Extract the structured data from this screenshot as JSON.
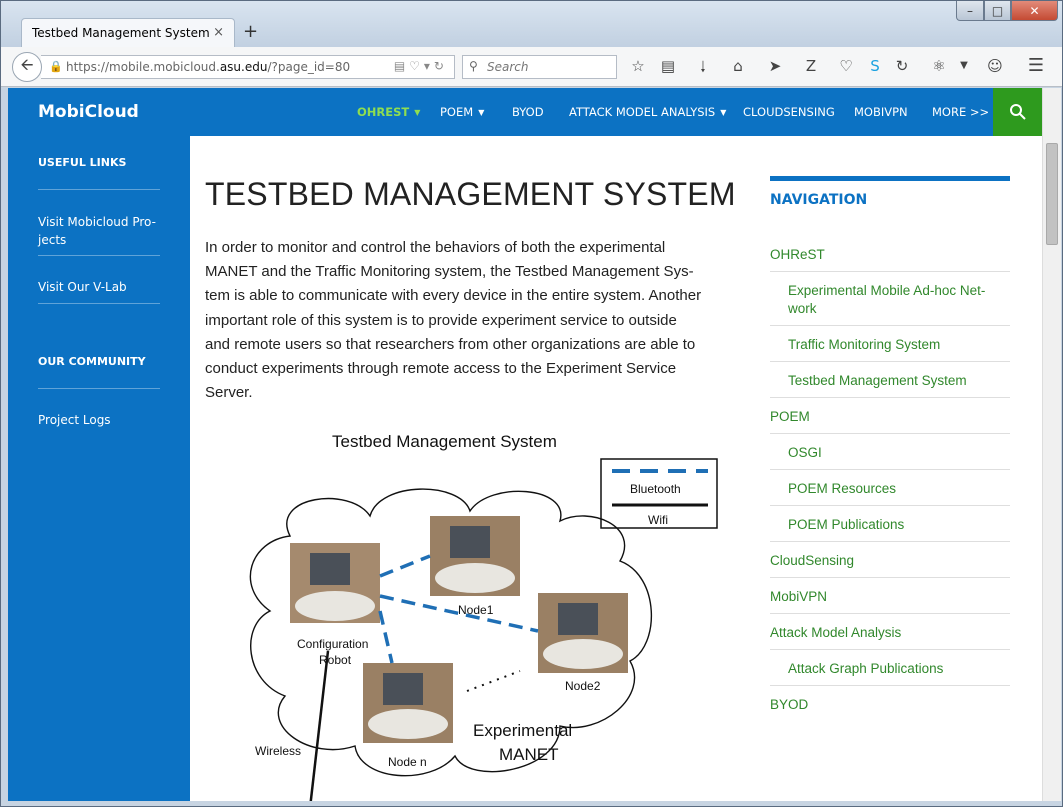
{
  "browser": {
    "tab_title": "Testbed Management System |...",
    "tab_close": "×",
    "new_tab": "+",
    "url_prefix": "https://mobile.mobicloud.",
    "url_domain": "asu.edu",
    "url_suffix": "/?page_id=80",
    "search_placeholder": "Search"
  },
  "site": {
    "brand": "MobiCloud",
    "menu": [
      {
        "label": "OHREST",
        "active": true,
        "dropdown": true
      },
      {
        "label": "POEM",
        "dropdown": true
      },
      {
        "label": "BYOD"
      },
      {
        "label": "ATTACK MODEL ANALYSIS",
        "dropdown": true
      },
      {
        "label": "CLOUDSENSING"
      },
      {
        "label": "MOBIVPN"
      },
      {
        "label": "MORE >>"
      }
    ],
    "accent_blue": "#0c72c3",
    "accent_green": "#2e9a1e",
    "link_green": "#31882c"
  },
  "left_sidebar": {
    "useful_links_heading": "USEFUL LINKS",
    "link1_line1": "Visit Mobicloud Pro-",
    "link1_line2": "jects",
    "link2": "Visit Our V-Lab",
    "community_heading": "OUR COMMUNITY",
    "link3": "Project Logs"
  },
  "content": {
    "title": "TESTBED MANAGEMENT SYSTEM",
    "intro_lines": [
      "In order to monitor and control the behaviors of both the experimental",
      "MANET and the Traffic Monitoring system, the Testbed Management Sys-",
      "tem is able to communicate with every device in the entire system. Another",
      "important role of this system is to provide experiment service to outside",
      "and remote users so that researchers from other organizations are able to",
      "conduct experiments through remote access to the Experiment Service",
      "Server."
    ]
  },
  "diagram": {
    "title": "Testbed Management System",
    "legend_bluetooth": "Bluetooth",
    "legend_wifi": "Wifi",
    "node1": "Node1",
    "node2": "Node2",
    "noden": "Node n",
    "config_line1": "Configuration",
    "config_line2": "Robot",
    "manet_line1": "Experimental",
    "manet_line2": "MANET",
    "wireless": "Wireless"
  },
  "right_sidebar": {
    "heading": "NAVIGATION",
    "items": [
      {
        "label": "OHReST",
        "sub": false
      },
      {
        "label": "Experimental Mobile Ad-hoc Net-",
        "label2": "work",
        "sub": true
      },
      {
        "label": "Traffic Monitoring System",
        "sub": true
      },
      {
        "label": "Testbed Management System",
        "sub": true
      },
      {
        "label": "POEM",
        "sub": false
      },
      {
        "label": "OSGI",
        "sub": true
      },
      {
        "label": "POEM Resources",
        "sub": true
      },
      {
        "label": "POEM Publications",
        "sub": true
      },
      {
        "label": "CloudSensing",
        "sub": false
      },
      {
        "label": "MobiVPN",
        "sub": false
      },
      {
        "label": "Attack Model Analysis",
        "sub": false
      },
      {
        "label": "Attack Graph Publications",
        "sub": true
      },
      {
        "label": "BYOD",
        "sub": false
      }
    ]
  }
}
